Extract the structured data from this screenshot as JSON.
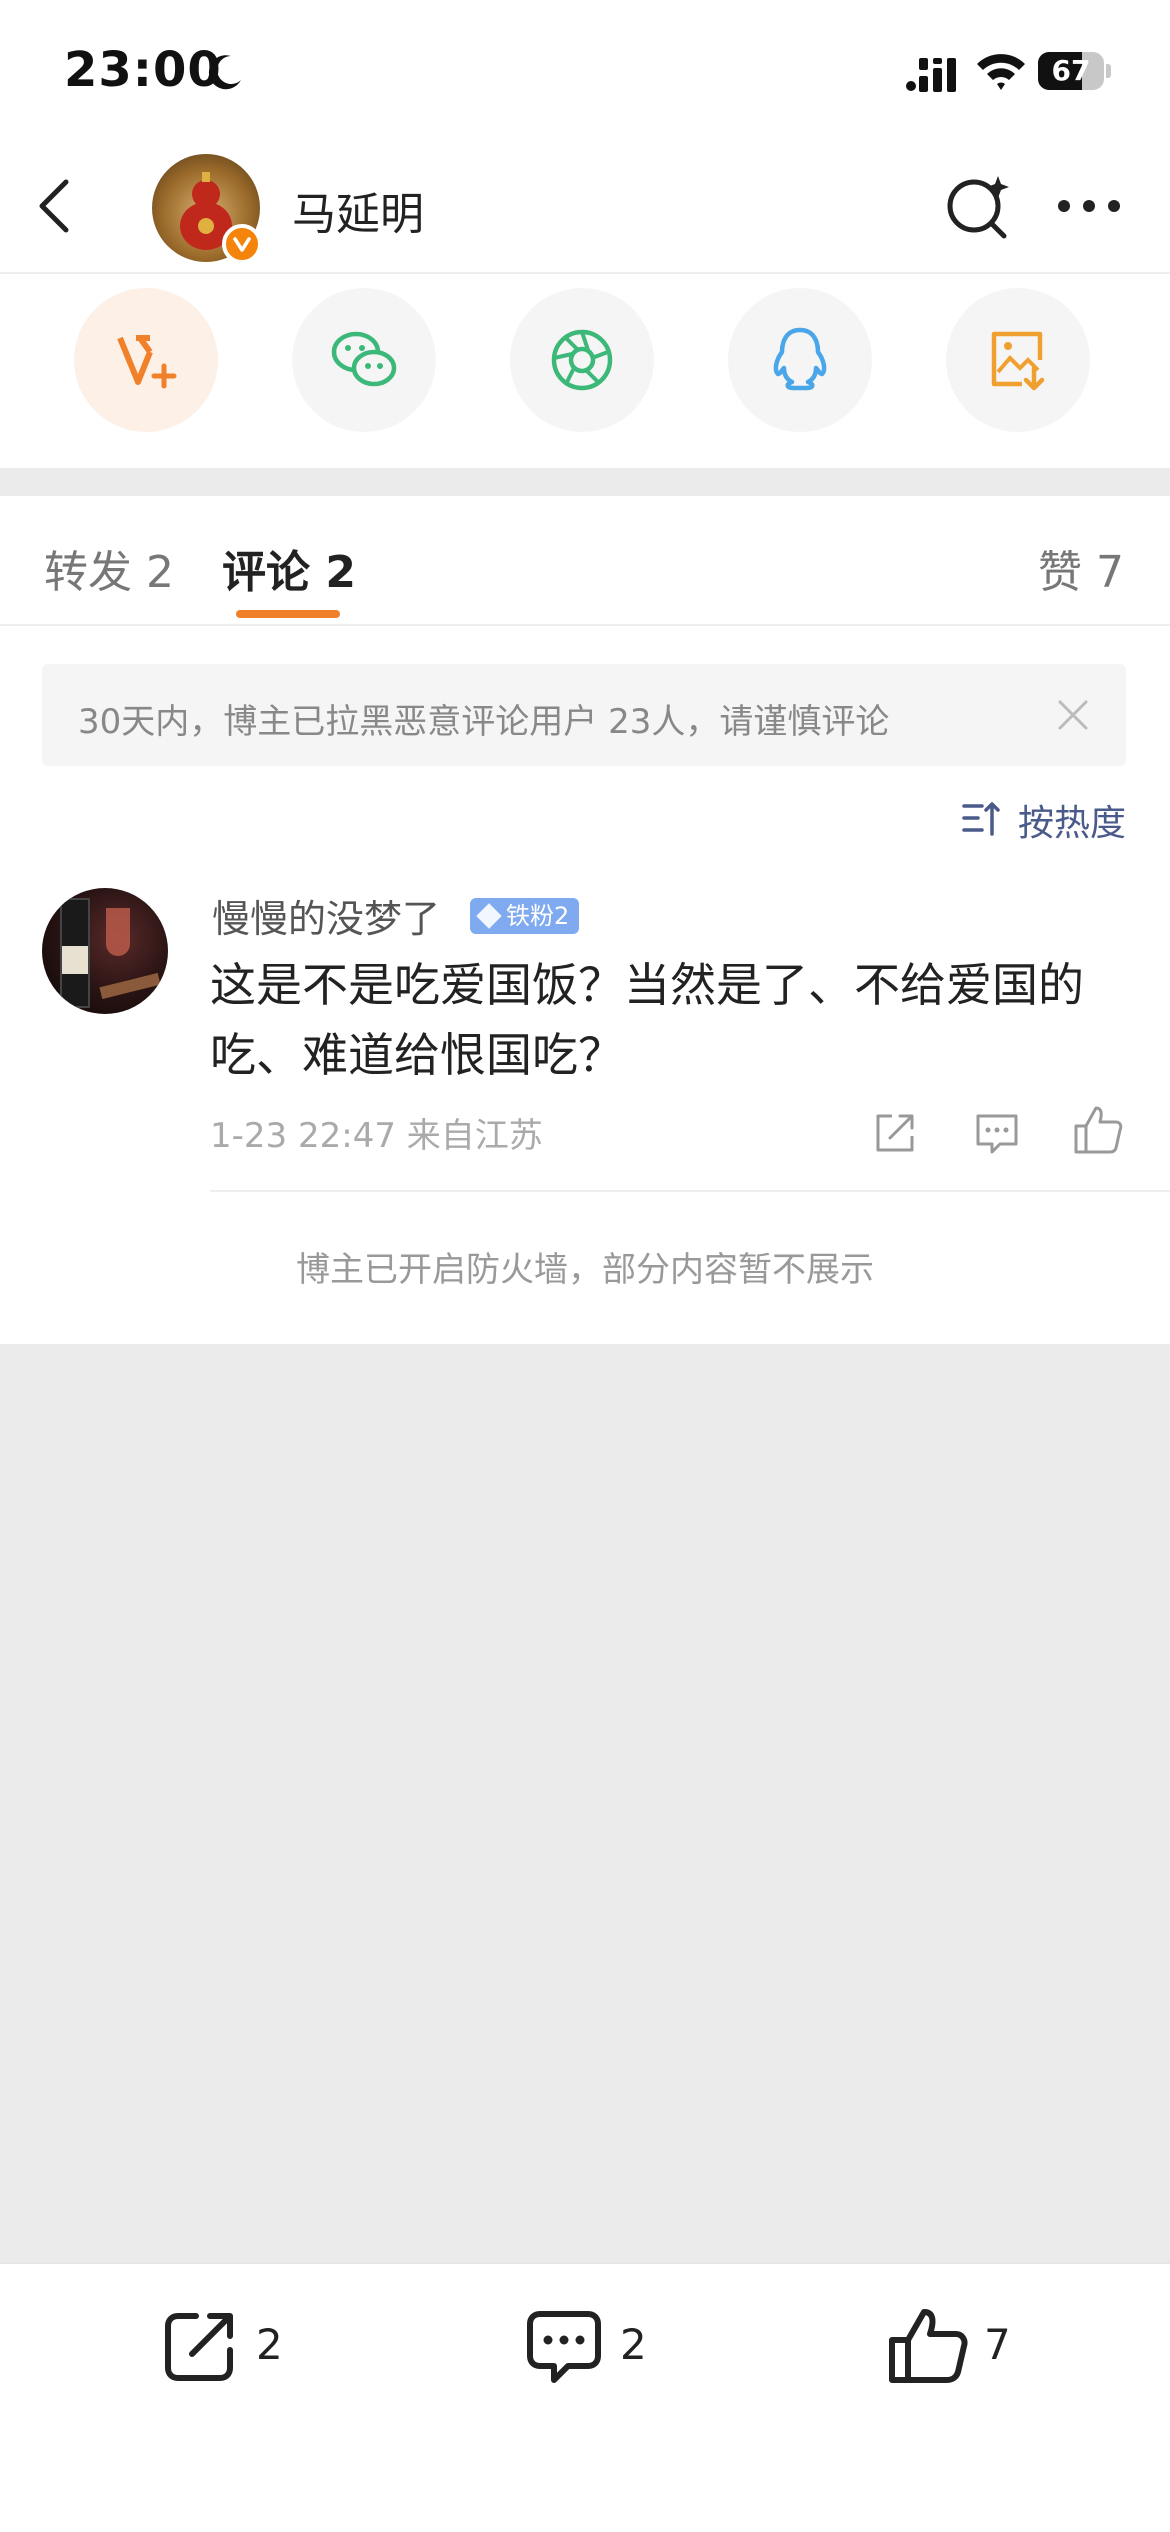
{
  "status_bar": {
    "time": "23:00",
    "battery": "67",
    "battery_level": 0.67
  },
  "header": {
    "title": "马延明"
  },
  "share_targets": [
    {
      "name": "weibo-v-plus-icon",
      "color": "#f0802a",
      "bg": "#fdf0e6"
    },
    {
      "name": "wechat-icon",
      "color": "#3cb878",
      "bg": "#f5f5f5"
    },
    {
      "name": "moments-icon",
      "color": "#3cb878",
      "bg": "#f5f5f5"
    },
    {
      "name": "qq-icon",
      "color": "#4aa6e8",
      "bg": "#f5f5f5"
    },
    {
      "name": "save-image-icon",
      "color": "#f0a030",
      "bg": "#f5f5f5"
    }
  ],
  "tabs": {
    "repost": "转发 2",
    "comments": "评论 2",
    "likes": "赞 7"
  },
  "notice": {
    "text": "30天内，博主已拉黑恶意评论用户 23人，请谨慎评论"
  },
  "sort": {
    "label": "按热度"
  },
  "comment": {
    "username": "慢慢的没梦了",
    "fan_badge": "铁粉2",
    "text": "这是不是吃爱国饭？当然是了、不给爱国的吃、难道给恨国吃？",
    "meta": "1-23 22:47  来自江苏"
  },
  "firewall_text": "博主已开启防火墙，部分内容暂不展示",
  "bottom_bar": {
    "repost_count": "2",
    "comment_count": "2",
    "like_count": "7"
  },
  "colors": {
    "accent": "#f0802a",
    "link": "#4a5a8a",
    "background": "#ebebeb"
  }
}
